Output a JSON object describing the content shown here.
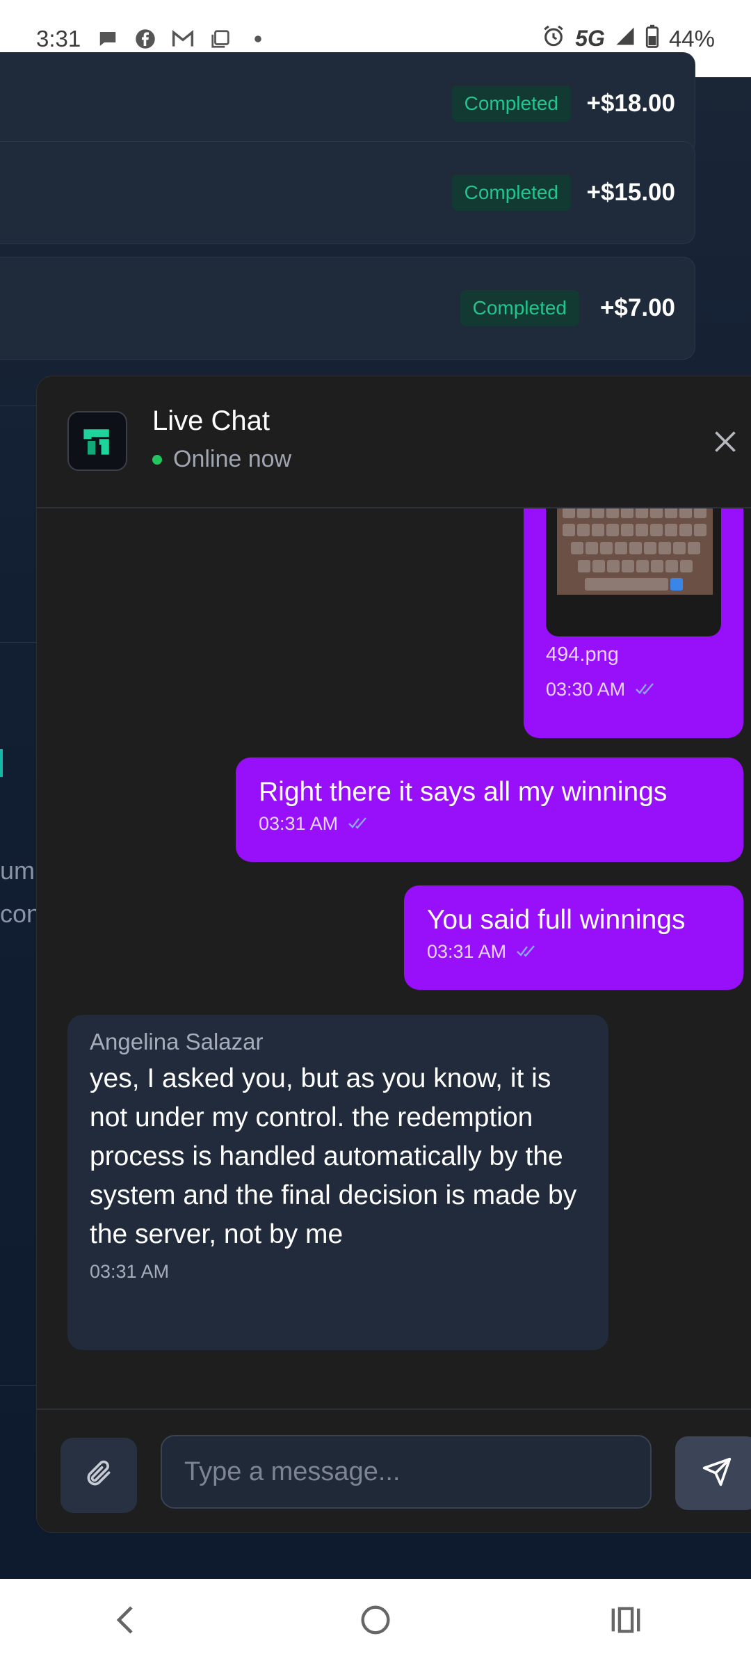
{
  "status_bar": {
    "time": "3:31",
    "network": "5G",
    "battery": "44%"
  },
  "transactions": [
    {
      "status": "Completed",
      "amount": "+$18.00"
    },
    {
      "status": "Completed",
      "amount": "+$15.00"
    },
    {
      "status": "Completed",
      "amount": "+$7.00"
    }
  ],
  "background_fragments": [
    "um",
    "con"
  ],
  "chat": {
    "title": "Live Chat",
    "status": "Online now",
    "messages": [
      {
        "direction": "out",
        "type": "image",
        "file_name": "494.png",
        "time": "03:30 AM"
      },
      {
        "direction": "out",
        "text": "Right there it says all my winnings",
        "time": "03:31 AM"
      },
      {
        "direction": "out",
        "text": "You said full winnings",
        "time": "03:31 AM"
      },
      {
        "direction": "in",
        "sender": "Angelina Salazar",
        "text": "yes, I asked you, but as you know, it is not under my control. the redemption process is handled automatically by the system and the final decision is made by the server, not by me",
        "time": "03:31 AM"
      }
    ],
    "input_placeholder": "Type a message..."
  },
  "colors": {
    "accent_purple": "#9810fa",
    "success_green": "#22c58e",
    "online_dot": "#22c55e"
  },
  "icons": [
    "message-icon",
    "facebook-icon",
    "gmail-icon",
    "copy-icon",
    "alarm-icon",
    "signal-icon",
    "battery-icon",
    "close-icon",
    "paperclip-icon",
    "send-icon",
    "back-icon",
    "home-icon",
    "recents-icon",
    "double-check-icon"
  ]
}
